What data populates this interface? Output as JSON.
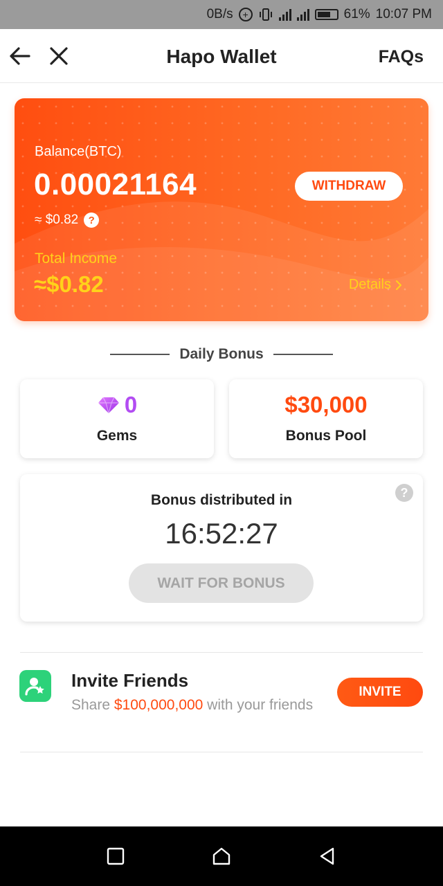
{
  "status_bar": {
    "speed": "0B/s",
    "battery_percent": "61%",
    "time": "10:07 PM"
  },
  "header": {
    "title": "Hapo Wallet",
    "faqs_label": "FAQs"
  },
  "balance_card": {
    "balance_label": "Balance(BTC)",
    "balance_value": "0.00021164",
    "balance_usd": "≈ $0.82",
    "withdraw_label": "WITHDRAW",
    "total_income_label": "Total Income",
    "total_income_value": "≈$0.82",
    "details_label": "Details"
  },
  "daily_bonus": {
    "heading": "Daily Bonus",
    "gems": {
      "value": "0",
      "label": "Gems"
    },
    "bonus_pool": {
      "value": "$30,000",
      "label": "Bonus Pool"
    },
    "timer": {
      "label": "Bonus distributed in",
      "value": "16:52:27",
      "button_label": "WAIT FOR BONUS"
    }
  },
  "invite": {
    "title": "Invite Friends",
    "desc_prefix": "Share ",
    "desc_amount": "$100,000,000",
    "desc_suffix": " with your friends",
    "button_label": "INVITE"
  },
  "colors": {
    "accent": "#ff4a10",
    "gold": "#ffd21a",
    "gem_purple": "#b24cf2",
    "invite_green": "#2dd27a"
  },
  "icons": {
    "back": "arrow-left-icon",
    "close": "close-icon",
    "help": "question-icon",
    "gem": "diamond-icon",
    "invite": "user-star-icon"
  }
}
